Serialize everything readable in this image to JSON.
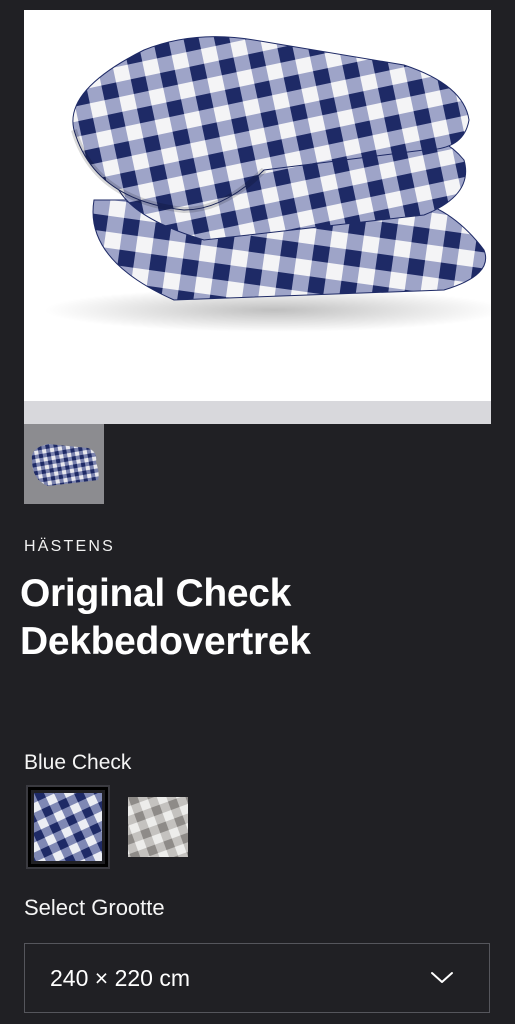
{
  "product": {
    "brand": "HÄSTENS",
    "title_line1": "Original Check",
    "title_line2": "Dekbedovertrek"
  },
  "variant": {
    "label": "Blue Check",
    "options": [
      "Blue Check",
      "Grey Check"
    ],
    "selected_index": 0
  },
  "size": {
    "label": "Select Grootte",
    "value": "240 × 220 cm"
  },
  "icons": {
    "dropdown": "chevron-down-icon",
    "product_image": "duvet-cover-image",
    "thumbnail": "duvet-thumbnail-image"
  },
  "colors": {
    "background": "#202024",
    "check_blue": "#1f2d6b",
    "check_grey": "#9a9896",
    "text": "#ffffff"
  }
}
